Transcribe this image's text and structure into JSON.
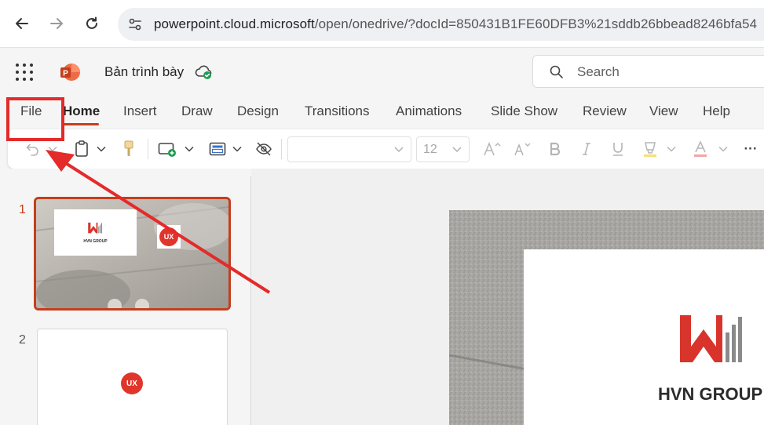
{
  "browser": {
    "url_host": "powerpoint.cloud.microsoft",
    "url_path": "/open/onedrive/?docId=850431B1FE60DFB3%21sddb26bbead8246bfa54"
  },
  "app": {
    "doc_title": "Bản trình bày",
    "search_placeholder": "Search"
  },
  "tabs": [
    {
      "label": "File"
    },
    {
      "label": "Home"
    },
    {
      "label": "Insert"
    },
    {
      "label": "Draw"
    },
    {
      "label": "Design"
    },
    {
      "label": "Transitions"
    },
    {
      "label": "Animations"
    },
    {
      "label": "Slide Show"
    },
    {
      "label": "Review"
    },
    {
      "label": "View"
    },
    {
      "label": "Help"
    }
  ],
  "toolbar": {
    "font_size": "12",
    "more_label": "···"
  },
  "slides": [
    {
      "number": "1",
      "logo_text": "HVN GROUP",
      "badge": "UX"
    },
    {
      "number": "2",
      "badge": "UX"
    }
  ],
  "main_slide": {
    "logo_text": "HVN GROUP"
  },
  "colors": {
    "accent": "#c43e1c",
    "annotation": "#e52a2a",
    "logo_red": "#d9342b"
  }
}
